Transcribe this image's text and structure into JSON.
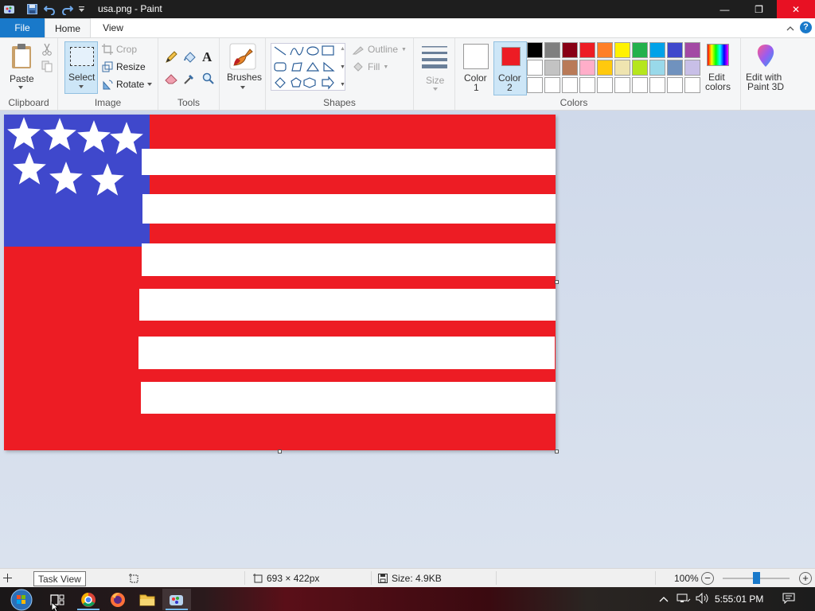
{
  "window": {
    "title": "usa.png - Paint",
    "minimize_glyph": "—",
    "maximize_glyph": "❐",
    "close_glyph": "✕"
  },
  "tabs": [
    "File",
    "Home",
    "View"
  ],
  "ribbon": {
    "clipboard": {
      "paste": "Paste",
      "group": "Clipboard"
    },
    "image": {
      "select": "Select",
      "crop": "Crop",
      "resize": "Resize",
      "rotate": "Rotate",
      "group": "Image"
    },
    "tools": {
      "group": "Tools",
      "text_glyph": "A"
    },
    "brushes": {
      "label": "Brushes"
    },
    "shapes": {
      "outline": "Outline",
      "fill": "Fill",
      "group": "Shapes"
    },
    "size": {
      "label": "Size"
    },
    "colors": {
      "color1": "Color",
      "color1_num": "1",
      "color2": "Color",
      "color2_num": "2",
      "edit_colors_1": "Edit",
      "edit_colors_2": "colors",
      "paint3d_1": "Edit with",
      "paint3d_2": "Paint 3D",
      "group": "Colors",
      "color1_value": "#ffffff",
      "color2_value": "#ed1c24",
      "palette_row1": [
        "#000000",
        "#7f7f7f",
        "#880015",
        "#ed1c24",
        "#ff7f27",
        "#fff200",
        "#22b14c",
        "#00a2e8",
        "#3f48cc",
        "#a349a4"
      ],
      "palette_row2": [
        "#ffffff",
        "#c3c3c3",
        "#b97a57",
        "#ffaec9",
        "#ffc90e",
        "#efe4b0",
        "#b5e61d",
        "#99d9ea",
        "#7092be",
        "#c8bfe7"
      ],
      "palette_row3": [
        "#ffffff",
        "#ffffff",
        "#ffffff",
        "#ffffff",
        "#ffffff",
        "#ffffff",
        "#ffffff",
        "#ffffff",
        "#ffffff",
        "#ffffff"
      ]
    }
  },
  "image": {
    "stripe_color": "#ffffff",
    "field_color": "#ed1c24",
    "union_color": "#3f48cc"
  },
  "status": {
    "dimensions": "693 × 422px",
    "size": "Size: 4.9KB",
    "zoom": "100%"
  },
  "tooltip": "Task View",
  "taskbar": {
    "clock": "5:55:01 PM"
  }
}
